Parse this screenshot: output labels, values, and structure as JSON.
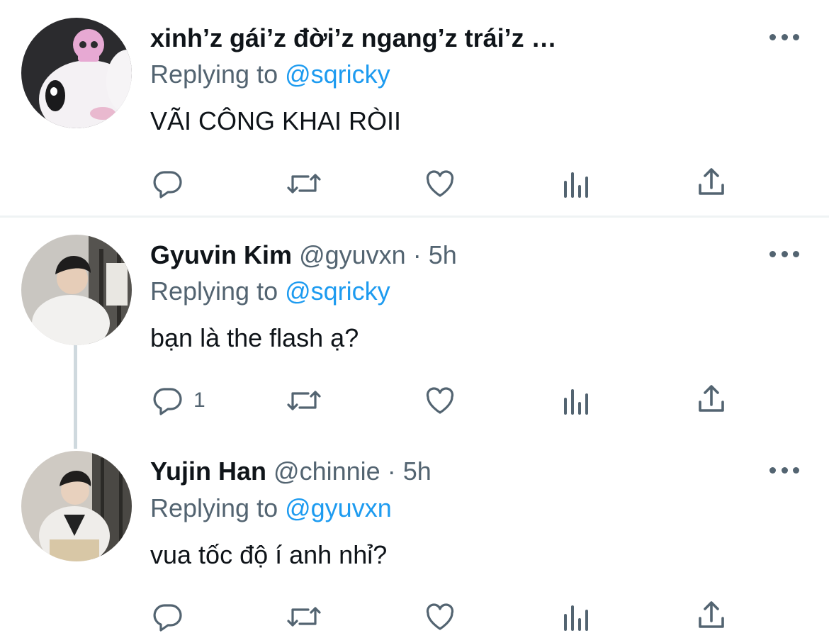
{
  "tweets": [
    {
      "name": "xinh’z gái’z đời’z ngang’z trái’z …",
      "handle": "",
      "time": "",
      "reply_prefix": "Replying to ",
      "reply_to": "@sqricky",
      "text": "VÃI CÔNG KHAI RÒII",
      "reply_count": ""
    },
    {
      "name": "Gyuvin Kim",
      "handle": "@gyuvxn",
      "separator": "·",
      "time": "5h",
      "reply_prefix": "Replying to ",
      "reply_to": "@sqricky",
      "text": "bạn là the flash ạ?",
      "reply_count": "1"
    },
    {
      "name": "Yujin Han",
      "handle": "@chinnie",
      "separator": "·",
      "time": "5h",
      "reply_prefix": "Replying to ",
      "reply_to": "@gyuvxn",
      "text": "vua tốc độ í anh nhỉ?",
      "reply_count": ""
    }
  ],
  "actions": [
    "reply-icon",
    "retweet-icon",
    "like-icon",
    "analytics-icon",
    "share-icon"
  ],
  "colors": {
    "accent": "#1d9bf0",
    "secondary_text": "#536471",
    "primary_text": "#0f1419",
    "divider": "#eff3f4"
  }
}
